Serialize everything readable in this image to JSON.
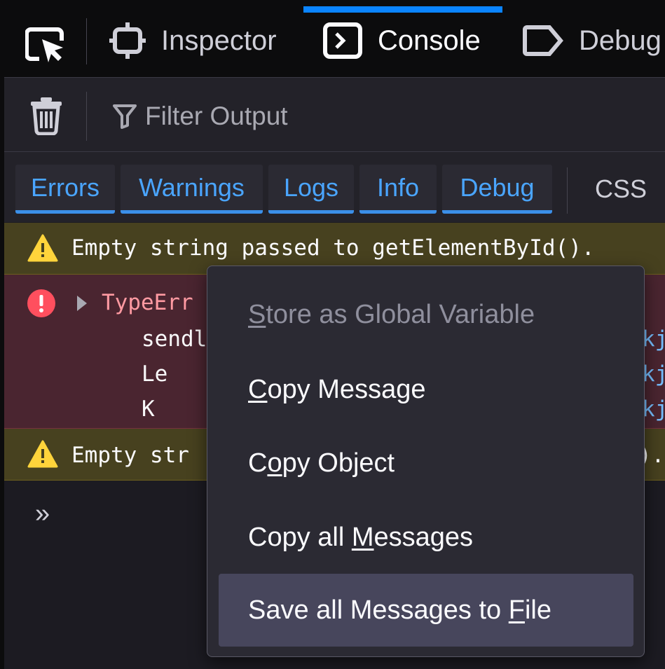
{
  "devtools": {
    "tabs": [
      {
        "label": "Inspector",
        "icon": "inspector-icon"
      },
      {
        "label": "Console",
        "icon": "console-icon",
        "selected": true
      },
      {
        "label": "Debug",
        "icon": "debugger-icon"
      }
    ],
    "picker_icon": "element-picker-icon"
  },
  "toolbar": {
    "clear_icon": "trash-icon",
    "filter_icon": "filter-icon",
    "filter_placeholder": "Filter Output"
  },
  "filters": {
    "chips": [
      "Errors",
      "Warnings",
      "Logs",
      "Info",
      "Debug"
    ],
    "css_label": "CSS"
  },
  "messages": {
    "warning1": "Empty string passed to getElementById().",
    "error_title": "TypeErr",
    "error_frames": [
      "sendl",
      "Le",
      "K"
    ],
    "error_links": [
      "kj",
      "kj",
      "kj"
    ],
    "warning2_left": "Empty str",
    "warning2_right": ")."
  },
  "console_prompt": "»",
  "context_menu": {
    "store_global": {
      "pre": "",
      "key": "S",
      "post": "tore as Global Variable"
    },
    "copy_message": {
      "pre": "",
      "key": "C",
      "post": "opy Message"
    },
    "copy_object": {
      "pre": "C",
      "key": "o",
      "post": "py Object"
    },
    "copy_all": {
      "pre": "Copy all ",
      "key": "M",
      "post": "essages"
    },
    "save_all": {
      "pre": "Save all Messages to ",
      "key": "F",
      "post": "ile"
    }
  },
  "colors": {
    "accent": "#0a84ff",
    "warning_bg": "#47411f",
    "error_bg": "#4a2530",
    "menu_bg": "#2b2a33",
    "menu_highlight": "#47465c"
  }
}
